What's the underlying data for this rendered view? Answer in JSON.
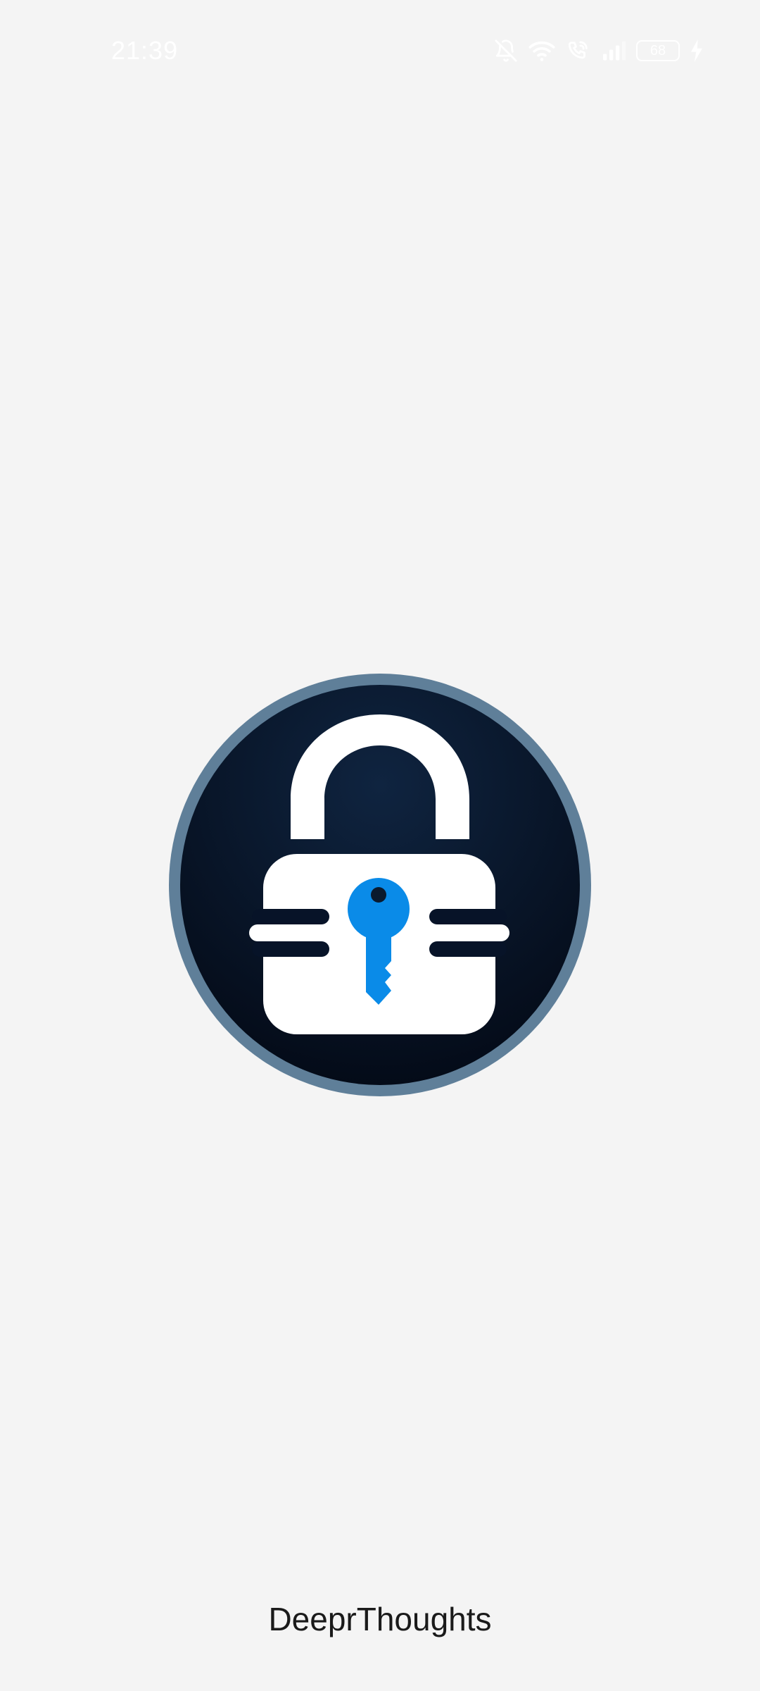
{
  "status_bar": {
    "time": "21:39",
    "battery_level": "68",
    "icons": [
      "bell-off-icon",
      "wifi-icon",
      "wifi-calling-icon",
      "signal-icon",
      "battery-icon",
      "charging-bolt-icon"
    ],
    "icon_color": "#ffffff"
  },
  "splash": {
    "logo_icon": "padlock-key-icon",
    "app_name": "DeeprThoughts"
  },
  "colors": {
    "background": "#f4f4f4",
    "logo_ring": "#5f7f99",
    "logo_fill": "#0a1a2e",
    "key_blue": "#0a8be8",
    "text": "#1a1a1a"
  }
}
